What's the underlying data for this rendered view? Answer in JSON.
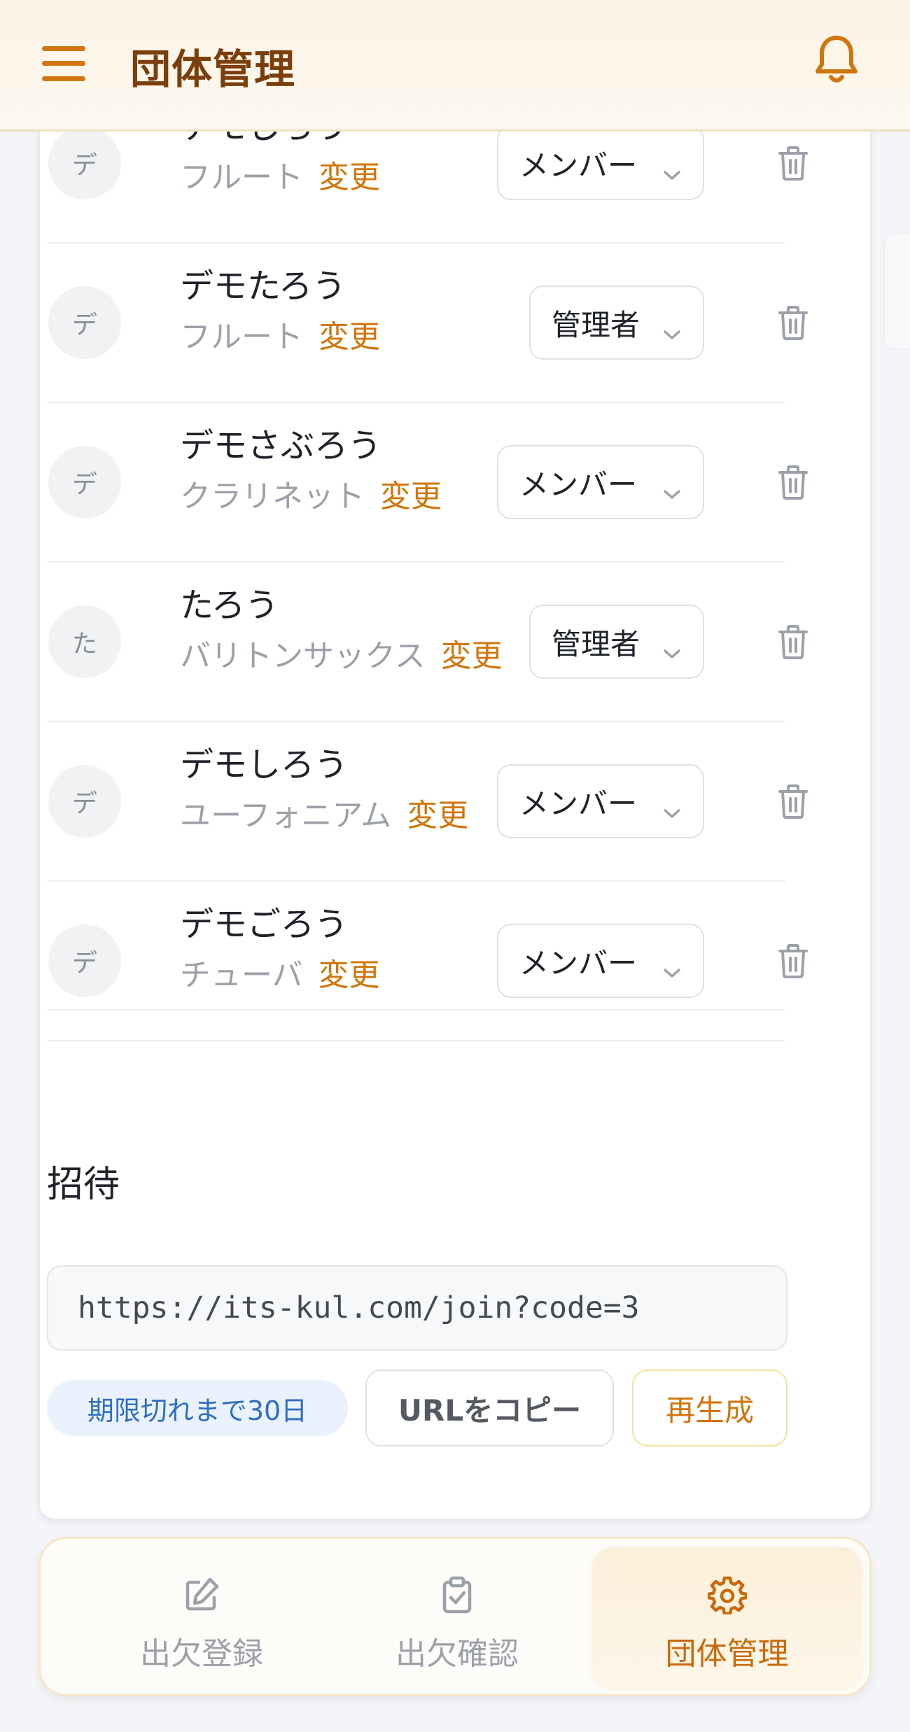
{
  "header": {
    "title": "団体管理"
  },
  "members": [
    {
      "avatar": "デ",
      "name": "デモじろう",
      "part": "フルート",
      "change_label": "変更",
      "role": "メンバー"
    },
    {
      "avatar": "デ",
      "name": "デモたろう",
      "part": "フルート",
      "change_label": "変更",
      "role": "管理者"
    },
    {
      "avatar": "デ",
      "name": "デモさぶろう",
      "part": "クラリネット",
      "change_label": "変更",
      "role": "メンバー"
    },
    {
      "avatar": "た",
      "name": "たろう",
      "part": "バリトンサックス",
      "change_label": "変更",
      "role": "管理者"
    },
    {
      "avatar": "デ",
      "name": "デモしろう",
      "part": "ユーフォニアム",
      "change_label": "変更",
      "role": "メンバー"
    },
    {
      "avatar": "デ",
      "name": "デモごろう",
      "part": "チューバ",
      "change_label": "変更",
      "role": "メンバー"
    }
  ],
  "invite": {
    "section_title": "招待",
    "url": "https://its-kul.com/join?code=3",
    "expiry_label": "期限切れまで30日",
    "copy_button": "URLをコピー",
    "regenerate_button": "再生成"
  },
  "bottom_nav": [
    {
      "label": "出欠登録",
      "icon": "edit-icon",
      "active": false
    },
    {
      "label": "出欠確認",
      "icon": "clipboard-check-icon",
      "active": false
    },
    {
      "label": "団体管理",
      "icon": "gear-icon",
      "active": true
    }
  ],
  "colors": {
    "accent": "#d0760c",
    "title": "#7a3f0c",
    "badge_bg": "#e9f2fc",
    "badge_text": "#2f6ec0"
  }
}
